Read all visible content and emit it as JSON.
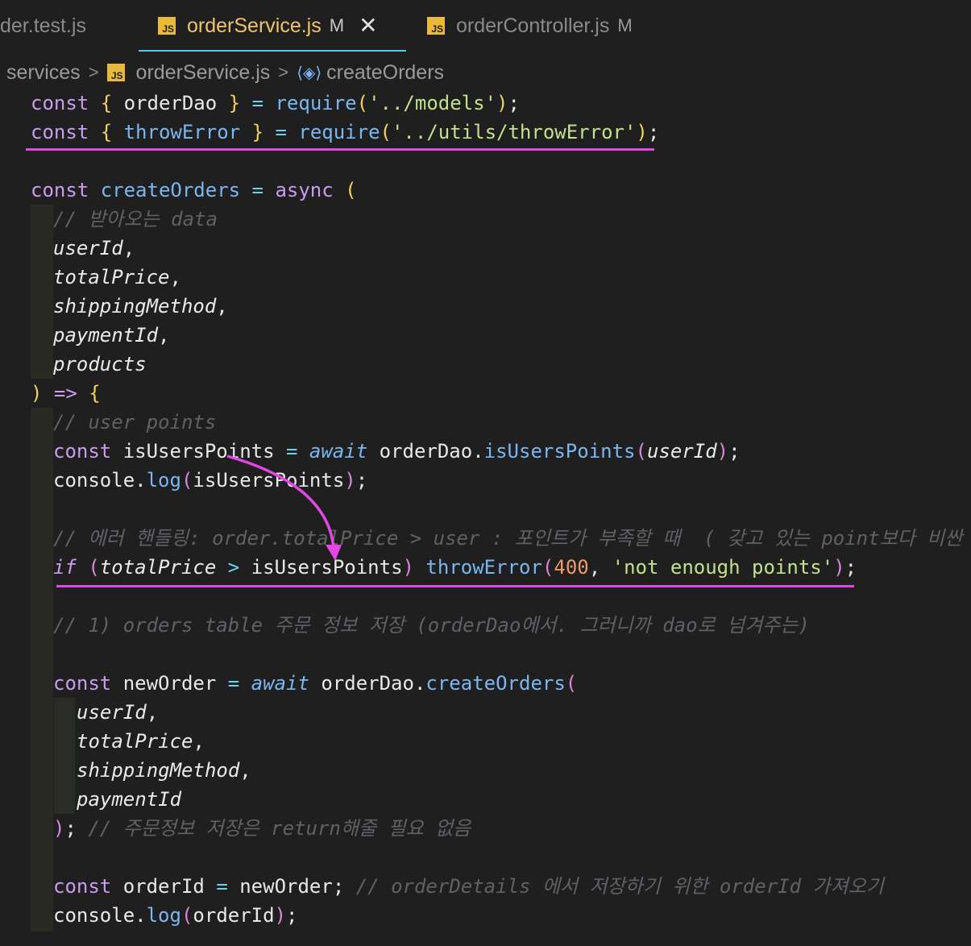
{
  "tabs": [
    {
      "name": "der.test.js",
      "modified": ""
    },
    {
      "name": "orderService.js",
      "modified": "M",
      "active": true
    },
    {
      "name": "orderController.js",
      "modified": "M"
    }
  ],
  "js_badge": "JS",
  "close_glyph": "✕",
  "breadcrumb": {
    "folder": "services",
    "file": "orderService.js",
    "symbol": "createOrders",
    "separator": ">"
  },
  "code": {
    "l1": {
      "kw": "const",
      "open": "{",
      "name": "orderDao",
      "close": "}",
      "eq": "=",
      "fn": "require",
      "lp": "(",
      "str": "'../models'",
      "rp": ")",
      "end": ";"
    },
    "l2": {
      "kw": "const",
      "open": "{",
      "name": "throwError",
      "close": "}",
      "eq": "=",
      "fn": "require",
      "lp": "(",
      "str": "'../utils/throwError'",
      "rp": ")",
      "end": ";"
    },
    "l4": {
      "kw": "const",
      "name": "createOrders",
      "eq": "=",
      "async": "async",
      "lp": "("
    },
    "l5": "// 받아오는 data",
    "l6": "userId",
    "l7": "totalPrice",
    "l8": "shippingMethod",
    "l9": "paymentId",
    "l10": "products",
    "l11": {
      "rp": ")",
      "arrow": "=>",
      "brace": "{"
    },
    "l12": "// user points",
    "l13": {
      "kw": "const",
      "name": "isUsersPoints",
      "eq": "=",
      "await": "await",
      "obj": "orderDao",
      "fn": "isUsersPoints",
      "arg": "userId"
    },
    "l14": {
      "obj": "console",
      "fn": "log",
      "arg": "isUsersPoints"
    },
    "l16": "// 에러 핸들링: order.totalPrice > user : 포인트가 부족할 때  ( 갖고 있는 point보다 비싼 걸",
    "l17": {
      "kw": "if",
      "a": "totalPrice",
      "op": ">",
      "b": "isUsersPoints",
      "fn": "throwError",
      "num": "400",
      "str": "'not enough points'"
    },
    "l19": "// 1) orders table 주문 정보 저장 (orderDao에서. 그러니까 dao로 넘겨주는)",
    "l21": {
      "kw": "const",
      "name": "newOrder",
      "eq": "=",
      "await": "await",
      "obj": "orderDao",
      "fn": "createOrders"
    },
    "l22": "userId",
    "l23": "totalPrice",
    "l24": "shippingMethod",
    "l25": "paymentId",
    "l26": {
      "rp": ")",
      "end": ";",
      "comment": "// 주문정보 저장은 return해줄 필요 없음"
    },
    "l28": {
      "kw": "const",
      "name": "orderId",
      "eq": "=",
      "val": "newOrder",
      "comment": "// orderDetails 에서 저장하기 위한 orderId 가져오기"
    },
    "l29": {
      "obj": "console",
      "fn": "log",
      "arg": "orderId"
    }
  },
  "colors": {
    "background": "#1f1f1f",
    "active_tab": "#f0c46a",
    "tab_underline": "#5ec7d9",
    "highlight": "#e447e4",
    "keyword": "#c99cf0",
    "function": "#7ab6f0",
    "string": "#c3e08a",
    "number": "#f09a6a",
    "comment": "#5f6166"
  }
}
